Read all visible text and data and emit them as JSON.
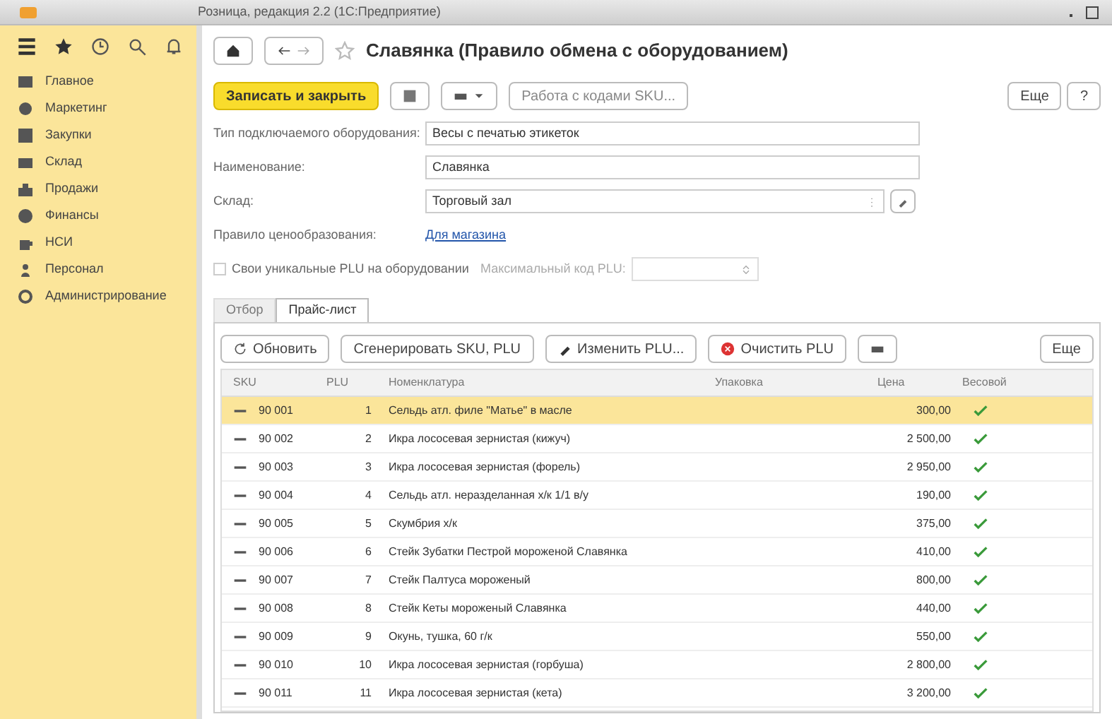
{
  "window": {
    "title": "Розница, редакция 2.2 (1С:Предприятие)"
  },
  "sidebar": {
    "items": [
      {
        "label": "Главное"
      },
      {
        "label": "Маркетинг"
      },
      {
        "label": "Закупки"
      },
      {
        "label": "Склад"
      },
      {
        "label": "Продажи"
      },
      {
        "label": "Финансы"
      },
      {
        "label": "НСИ"
      },
      {
        "label": "Персонал"
      },
      {
        "label": "Администрирование"
      }
    ]
  },
  "form": {
    "title": "Славянка (Правило обмена с оборудованием)",
    "toolbar": {
      "save_close": "Записать и закрыть",
      "sku_button": "Работа с кодами SKU...",
      "more": "Еще",
      "help": "?"
    },
    "fields": [
      {
        "kind": "text",
        "label": "Тип подключаемого оборудования:",
        "value": "Весы с печатью этикеток"
      },
      {
        "kind": "text",
        "label": "Наименование:",
        "value": "Славянка"
      },
      {
        "kind": "select",
        "label": "Склад:",
        "value": "Торговый зал"
      },
      {
        "kind": "link",
        "label": "Правило ценообразования:",
        "value": "Для магазина"
      }
    ],
    "plu_option": {
      "checked": false,
      "label": "Свои уникальные PLU на оборудовании",
      "max_label": "Максимальный код PLU:"
    },
    "tabs": [
      {
        "label": "Отбор",
        "selected": false
      },
      {
        "label": "Прайс-лист",
        "selected": true
      }
    ],
    "table_toolbar": {
      "refresh": "Обновить",
      "generate": "Сгенерировать SKU, PLU",
      "edit": "Изменить PLU...",
      "clear": "Очистить PLU",
      "more": "Еще"
    },
    "table": {
      "columns": [
        "SKU",
        "PLU",
        "Номенклатура",
        "Упаковка",
        "Цена",
        "Весовой"
      ],
      "rows": [
        {
          "sku": "90 001",
          "plu": "1",
          "item": "Сельдь атл. филе \"Матье\" в масле",
          "price": "300,00",
          "weighted": true,
          "selected": true
        },
        {
          "sku": "90 002",
          "plu": "2",
          "item": "Икра лососевая зернистая (кижуч)",
          "price": "2 500,00",
          "weighted": true,
          "selected": false
        },
        {
          "sku": "90 003",
          "plu": "3",
          "item": "Икра лососевая зернистая (форель)",
          "price": "2 950,00",
          "weighted": true,
          "selected": false
        },
        {
          "sku": "90 004",
          "plu": "4",
          "item": "Сельдь атл. неразделанная х/к 1/1 в/у",
          "price": "190,00",
          "weighted": true,
          "selected": false
        },
        {
          "sku": "90 005",
          "plu": "5",
          "item": "Скумбрия х/к",
          "price": "375,00",
          "weighted": true,
          "selected": false
        },
        {
          "sku": "90 006",
          "plu": "6",
          "item": "Стейк Зубатки Пестрой мороженой Славянка",
          "price": "410,00",
          "weighted": true,
          "selected": false
        },
        {
          "sku": "90 007",
          "plu": "7",
          "item": "Стейк Палтуса мороженый",
          "price": "800,00",
          "weighted": true,
          "selected": false
        },
        {
          "sku": "90 008",
          "plu": "8",
          "item": "Стейк Кеты мороженый Славянка",
          "price": "440,00",
          "weighted": true,
          "selected": false
        },
        {
          "sku": "90 009",
          "plu": "9",
          "item": "Окунь, тушка, 60 г/к",
          "price": "550,00",
          "weighted": true,
          "selected": false
        },
        {
          "sku": "90 010",
          "plu": "10",
          "item": "Икра лососевая зернистая (горбуша)",
          "price": "2 800,00",
          "weighted": true,
          "selected": false
        },
        {
          "sku": "90 011",
          "plu": "11",
          "item": "Икра лососевая зернистая (кета)",
          "price": "3 200,00",
          "weighted": true,
          "selected": false
        }
      ]
    }
  }
}
